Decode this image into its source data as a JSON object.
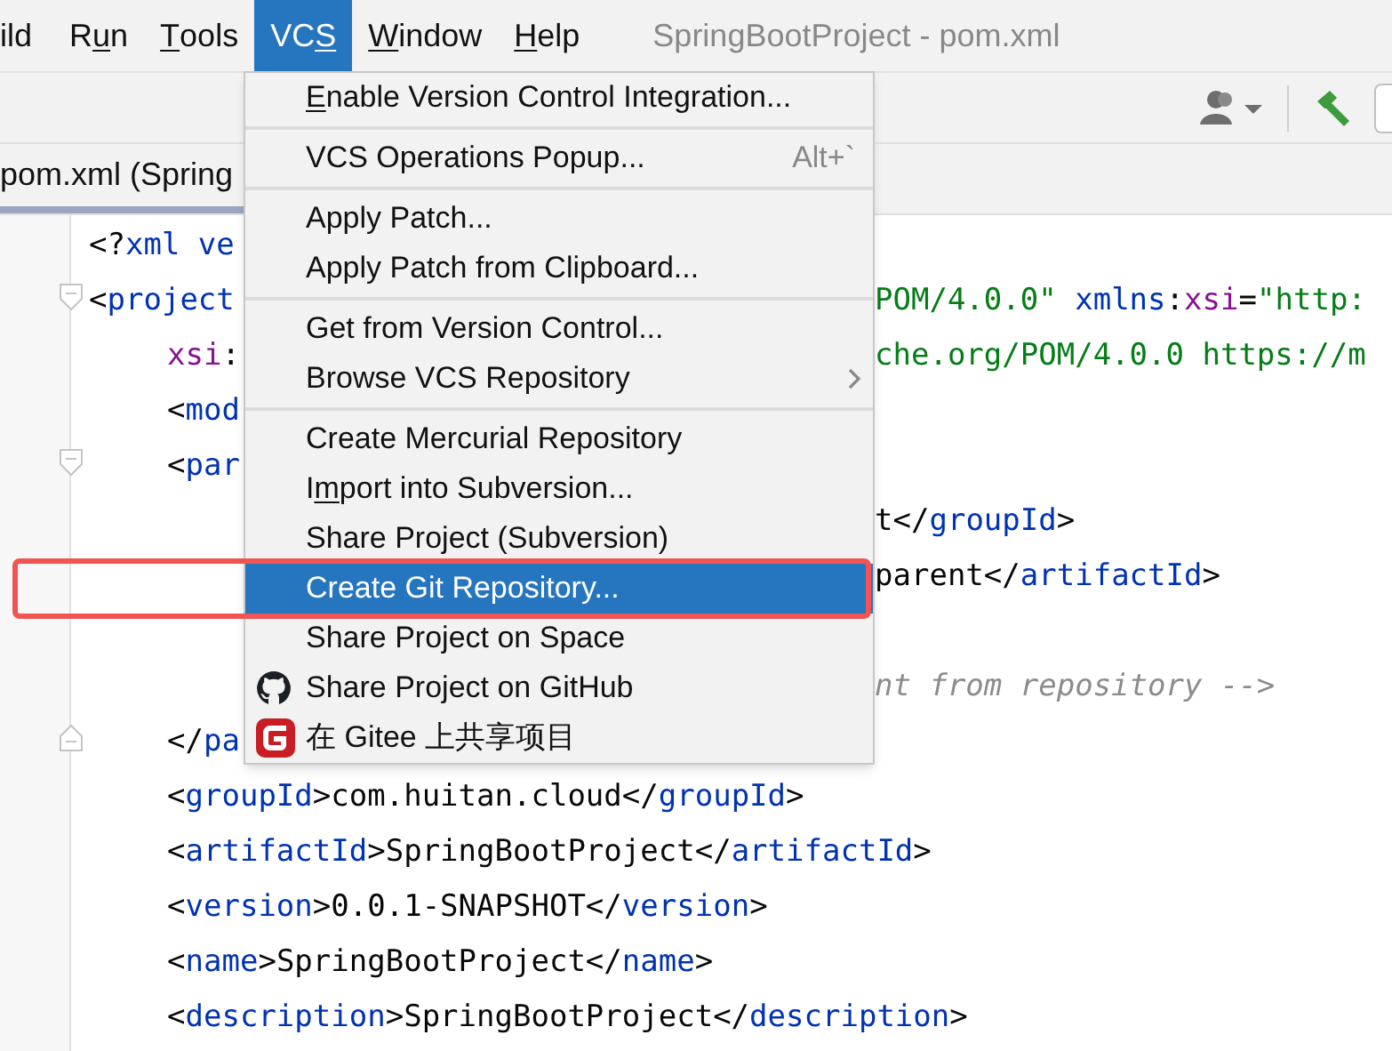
{
  "menubar": [
    {
      "label": "ild",
      "selected": false
    },
    {
      "before": "R",
      "mnemonic": "u",
      "after": "n",
      "selected": false
    },
    {
      "mnemonic": "T",
      "after": "ools",
      "selected": false
    },
    {
      "before": "VC",
      "mnemonic": "S",
      "selected": true
    },
    {
      "mnemonic": "W",
      "after": "indow",
      "selected": false
    },
    {
      "mnemonic": "H",
      "after": "elp",
      "selected": false
    }
  ],
  "window": {
    "title": "SpringBootProject - pom.xml"
  },
  "tab": {
    "label": "pom.xml (Spring",
    "selected": true
  },
  "menu": {
    "groups": [
      [
        {
          "mnemonic": "E",
          "after": "nable Version Control Integration...",
          "selected": false
        }
      ],
      [
        {
          "label": "VCS Operations Popup...",
          "shortcut": "Alt+`",
          "selected": false
        }
      ],
      [
        {
          "label": "Apply Patch...",
          "selected": false
        },
        {
          "label": "Apply Patch from Clipboard...",
          "selected": false
        }
      ],
      [
        {
          "label": "Get from Version Control...",
          "selected": false
        },
        {
          "label": "Browse VCS Repository",
          "submenu": true,
          "selected": false
        }
      ],
      [
        {
          "label": "Create Mercurial Repository",
          "selected": false
        },
        {
          "before": "I",
          "mnemonic": "m",
          "after": "port into Subversion...",
          "selected": false
        },
        {
          "label": "Share Project (Subversion)",
          "selected": false
        },
        {
          "label": "Create Git Repository...",
          "selected": true
        },
        {
          "label": "Share Project on Space",
          "selected": false
        },
        {
          "label": "Share Project on GitHub",
          "kind": "github",
          "selected": false
        },
        {
          "label": "在 Gitee 上共享项目",
          "kind": "gitee",
          "selected": false
        }
      ]
    ]
  },
  "code_lines": [
    {
      "left": [
        {
          "kind": "bracket",
          "text": "<?"
        },
        {
          "kind": "tag",
          "text": "xml ve"
        }
      ]
    },
    {
      "foldable": true,
      "left": [
        {
          "kind": "bracket",
          "text": "<"
        },
        {
          "kind": "tag",
          "text": "project"
        }
      ],
      "right": [
        {
          "kind": "string",
          "text": "POM/4.0.0\" "
        },
        {
          "kind": "tag",
          "text": "xmlns"
        },
        {
          "kind": "bracket",
          "text": ":"
        },
        {
          "kind": "attr",
          "text": "xsi"
        },
        {
          "kind": "bracket",
          "text": "="
        },
        {
          "kind": "string",
          "text": "\"http:"
        }
      ],
      "children": [
        {
          "left": [
            {
              "kind": "attr",
              "text": "xsi"
            },
            {
              "kind": "bracket",
              "text": ":"
            }
          ],
          "right": [
            {
              "kind": "string",
              "text": "che.org/POM/4.0.0 https://m"
            }
          ]
        },
        {
          "left": [
            {
              "kind": "bracket",
              "text": "<"
            },
            {
              "kind": "tag",
              "text": "mod"
            }
          ]
        },
        {
          "foldable": true,
          "left": [
            {
              "kind": "bracket",
              "text": "<"
            },
            {
              "kind": "tag",
              "text": "par"
            }
          ],
          "children": [
            {
              "right": [
                {
                  "kind": "bracket",
                  "text": "t</"
                },
                {
                  "kind": "tag",
                  "text": "groupId"
                },
                {
                  "kind": "bracket",
                  "text": ">"
                }
              ]
            },
            {
              "right": [
                {
                  "kind": "bracket",
                  "text": "parent</"
                },
                {
                  "kind": "tag",
                  "text": "artifactId"
                },
                {
                  "kind": "bracket",
                  "text": ">"
                }
              ]
            },
            {
              "blank": true
            },
            {
              "right": [
                {
                  "kind": "comment",
                  "text": "nt from repository -->"
                }
              ]
            }
          ]
        },
        {
          "fold_end": true,
          "left": [
            {
              "kind": "bracket",
              "text": "</"
            },
            {
              "kind": "tag",
              "text": "pa"
            }
          ]
        },
        {
          "left": [
            {
              "kind": "bracket",
              "text": "<"
            },
            {
              "kind": "tag",
              "text": "groupId"
            },
            {
              "kind": "bracket",
              "text": ">com.huitan.cloud</"
            },
            {
              "kind": "tag",
              "text": "groupId"
            },
            {
              "kind": "bracket",
              "text": ">"
            }
          ]
        },
        {
          "left": [
            {
              "kind": "bracket",
              "text": "<"
            },
            {
              "kind": "tag",
              "text": "artifactId"
            },
            {
              "kind": "bracket",
              "text": ">SpringBootProject</"
            },
            {
              "kind": "tag",
              "text": "artifactId"
            },
            {
              "kind": "bracket",
              "text": ">"
            }
          ]
        },
        {
          "left": [
            {
              "kind": "bracket",
              "text": "<"
            },
            {
              "kind": "tag",
              "text": "version"
            },
            {
              "kind": "bracket",
              "text": ">0.0.1-SNAPSHOT</"
            },
            {
              "kind": "tag",
              "text": "version"
            },
            {
              "kind": "bracket",
              "text": ">"
            }
          ]
        },
        {
          "left": [
            {
              "kind": "bracket",
              "text": "<"
            },
            {
              "kind": "tag",
              "text": "name"
            },
            {
              "kind": "bracket",
              "text": ">SpringBootProject</"
            },
            {
              "kind": "tag",
              "text": "name"
            },
            {
              "kind": "bracket",
              "text": ">"
            }
          ]
        },
        {
          "left": [
            {
              "kind": "bracket",
              "text": "<"
            },
            {
              "kind": "tag",
              "text": "description"
            },
            {
              "kind": "bracket",
              "text": ">SpringBootProject</"
            },
            {
              "kind": "tag",
              "text": "description"
            },
            {
              "kind": "bracket",
              "text": ">"
            }
          ]
        }
      ]
    }
  ]
}
